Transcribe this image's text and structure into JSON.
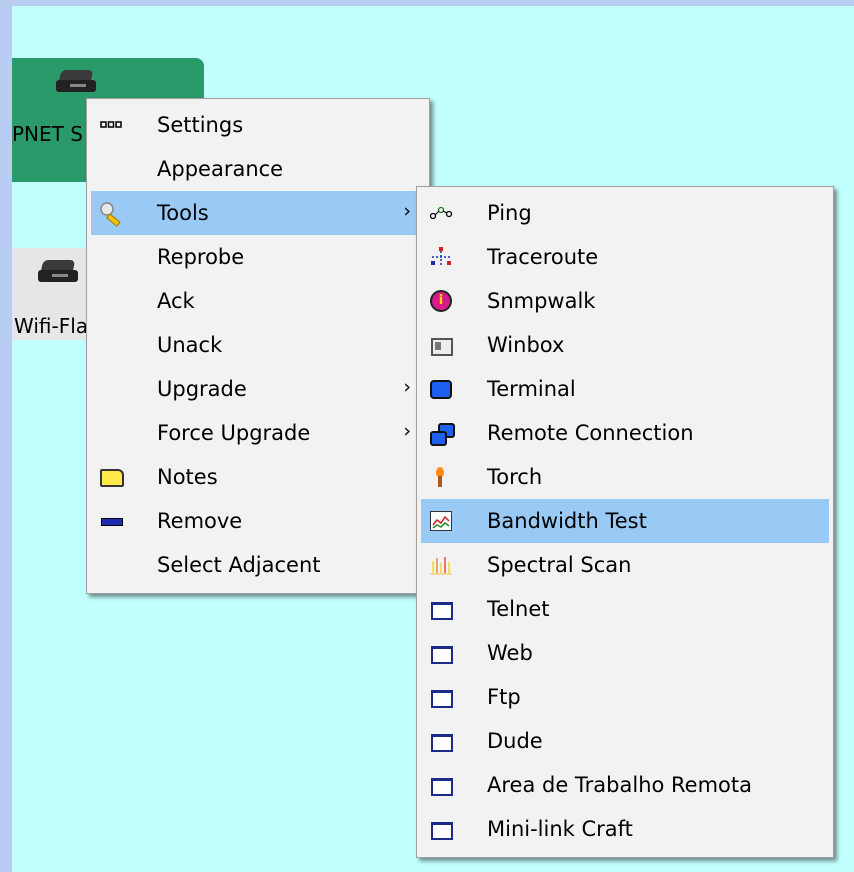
{
  "map": {
    "node1_label": "PNET S",
    "node2_label": "Wifi-Fla"
  },
  "main_menu": {
    "items": [
      {
        "label": "Settings",
        "icon": "settings-dots-icon"
      },
      {
        "label": "Appearance",
        "icon": ""
      },
      {
        "label": "Tools",
        "icon": "tools-wrench-icon",
        "submenu": true,
        "highlighted": true
      },
      {
        "label": "Reprobe",
        "icon": ""
      },
      {
        "label": "Ack",
        "icon": ""
      },
      {
        "label": "Unack",
        "icon": ""
      },
      {
        "label": "Upgrade",
        "icon": "",
        "submenu": true
      },
      {
        "label": "Force Upgrade",
        "icon": "",
        "submenu": true
      },
      {
        "label": "Notes",
        "icon": "notes-icon"
      },
      {
        "label": "Remove",
        "icon": "remove-icon"
      },
      {
        "label": "Select Adjacent",
        "icon": ""
      }
    ],
    "submenu_arrow": "›"
  },
  "tools_menu": {
    "items": [
      {
        "label": "Ping",
        "icon": "ping-icon"
      },
      {
        "label": "Traceroute",
        "icon": "traceroute-icon"
      },
      {
        "label": "Snmpwalk",
        "icon": "snmpwalk-icon"
      },
      {
        "label": "Winbox",
        "icon": "winbox-icon"
      },
      {
        "label": "Terminal",
        "icon": "terminal-icon"
      },
      {
        "label": "Remote Connection",
        "icon": "remote-connection-icon"
      },
      {
        "label": "Torch",
        "icon": "torch-icon"
      },
      {
        "label": "Bandwidth Test",
        "icon": "bandwidth-test-icon",
        "highlighted": true
      },
      {
        "label": "Spectral Scan",
        "icon": "spectral-scan-icon"
      },
      {
        "label": "Telnet",
        "icon": "window-icon"
      },
      {
        "label": "Web",
        "icon": "window-icon"
      },
      {
        "label": "Ftp",
        "icon": "window-icon"
      },
      {
        "label": "Dude",
        "icon": "window-icon"
      },
      {
        "label": "Area de Trabalho Remota",
        "icon": "window-icon"
      },
      {
        "label": "Mini-link Craft",
        "icon": "window-icon"
      }
    ]
  },
  "colors": {
    "canvas_bg": "#c2ffff",
    "highlight": "#99c9f5",
    "node_green": "#2a9a6a"
  }
}
